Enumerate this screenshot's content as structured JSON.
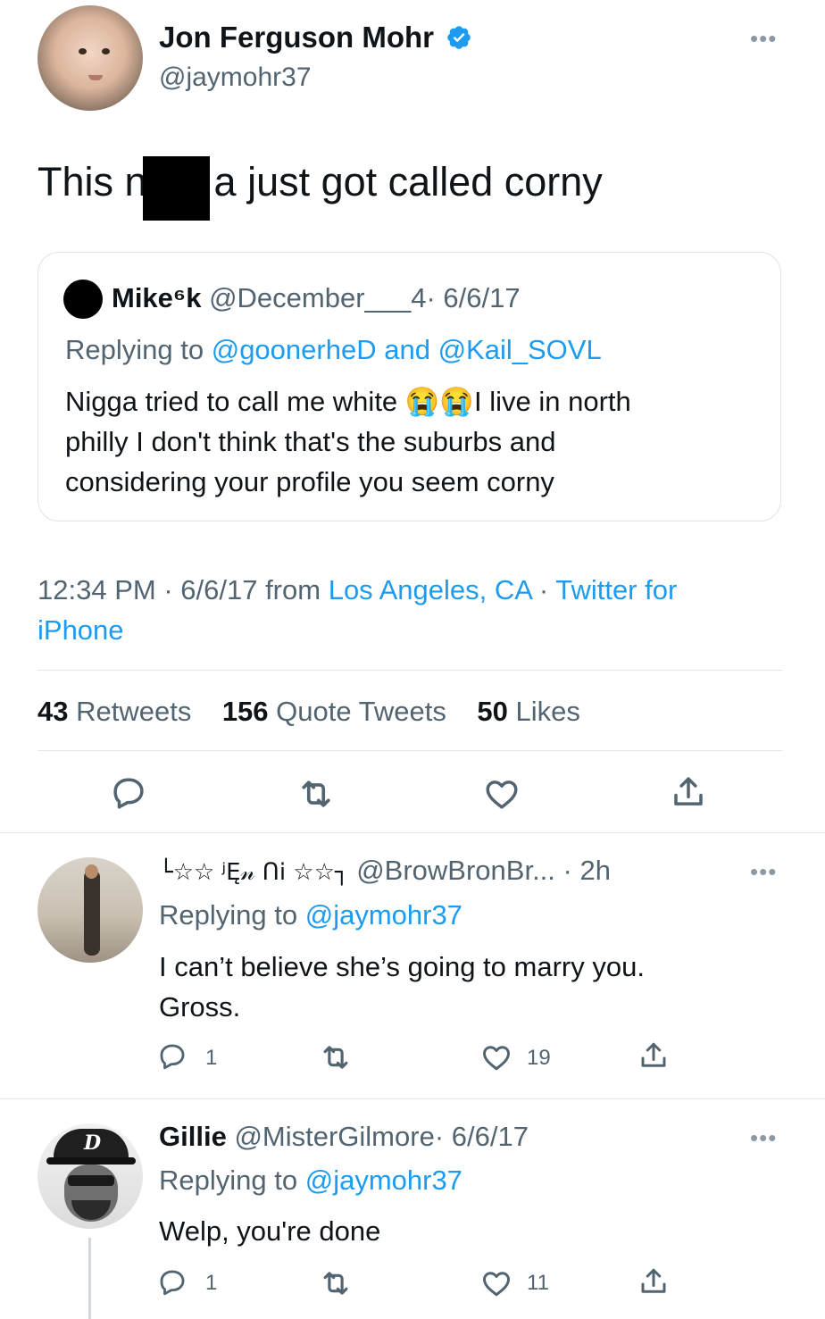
{
  "main_tweet": {
    "author_name": "Jon Ferguson Mohr",
    "handle": "@jaymohr37",
    "text_before": "This n",
    "text_after": "a just got called corny",
    "quoted": {
      "author_name": "Mike⁶k",
      "handle": "@December___4",
      "date": "· 6/6/17",
      "replying_label": "Replying to",
      "reply_to_1": "@goonerheD",
      "and": "and",
      "reply_to_2": "@Kail_SOVL",
      "text_line1": "Nigga tried to call me white",
      "text_line1_after": "I live in north",
      "text_line2": "philly I don't think that's the suburbs and",
      "text_line3": "considering your profile you seem corny",
      "emoji": "😭"
    },
    "time": "12:34 PM",
    "date_from": "· 6/6/17 from",
    "location": "Los Angeles, CA",
    "dot": "·",
    "client_line1": "Twitter for",
    "client_line2": "iPhone",
    "stats": {
      "retweets_count": "43",
      "retweets_label": "Retweets",
      "quotes_count": "156",
      "quotes_label": "Quote Tweets",
      "likes_count": "50",
      "likes_label": "Likes"
    }
  },
  "replies": [
    {
      "author_name": "└☆☆ ʲĘ𝓃 ᑎi ☆☆┐",
      "handle": "@BrowBronBr...",
      "time": "· 2h",
      "replying_label": "Replying to",
      "reply_to": "@jaymohr37",
      "text_line1": "I can’t believe she’s going to marry you.",
      "text_line2": "Gross.",
      "replies_count": "1",
      "likes_count": "19"
    },
    {
      "author_name": "Gillie",
      "handle": "@MisterGilmore",
      "time": "· 6/6/17",
      "replying_label": "Replying to",
      "reply_to": "@jaymohr37",
      "text_line1": "Welp, you're done",
      "replies_count": "1",
      "likes_count": "11"
    }
  ],
  "icons": [
    "verified-badge-icon",
    "more-icon",
    "reply-icon",
    "retweet-icon",
    "like-icon",
    "share-icon",
    "emoji-loudly-crying"
  ],
  "colors": {
    "link": "#1d9bf0",
    "text": "#0f1419",
    "secondary": "#536471",
    "border": "#e3e7ea"
  }
}
